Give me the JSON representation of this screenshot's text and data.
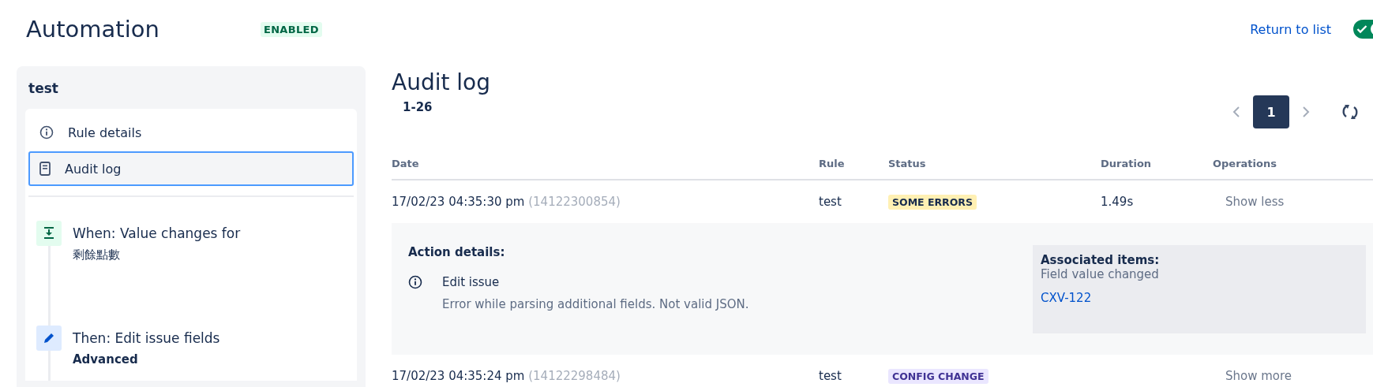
{
  "header": {
    "title": "Automation",
    "status_badge": "ENABLED",
    "return_link": "Return to list",
    "rule_toggle": {
      "on": true
    }
  },
  "sidebar": {
    "rule_name": "test",
    "nav": [
      {
        "label": "Rule details",
        "kind": "info",
        "selected": false
      },
      {
        "label": "Audit log",
        "kind": "document",
        "selected": true
      }
    ],
    "steps": [
      {
        "kind": "trigger",
        "title": "When: Value changes for",
        "detail": "剩餘點數"
      },
      {
        "kind": "action",
        "title": "Then: Edit issue fields",
        "detail": "Advanced"
      }
    ]
  },
  "main": {
    "title": "Audit log",
    "range": "1-26",
    "pagination": {
      "pages": [
        {
          "label": "1",
          "selected": true
        }
      ]
    },
    "table": {
      "columns": [
        "Date",
        "Rule",
        "Status",
        "Duration",
        "Operations"
      ],
      "rows": [
        {
          "date": "17/02/23 04:35:30 pm",
          "id": "(14122300854)",
          "rule": "test",
          "status": "SOME ERRORS",
          "kind": "error",
          "duration": "1.49s",
          "operation": "Show less",
          "details": {
            "heading": "Action details:",
            "action": "Edit issue",
            "message": "Error while parsing additional fields. Not valid JSON.",
            "associated_heading": "Associated items:",
            "associated_text": "Field value changed",
            "associated_link": "CXV-122"
          }
        },
        {
          "date": "17/02/23 04:35:24 pm",
          "id": "(14122298484)",
          "rule": "test",
          "status": "CONFIG CHANGE",
          "kind": "config",
          "operation": "Show more"
        }
      ]
    }
  }
}
